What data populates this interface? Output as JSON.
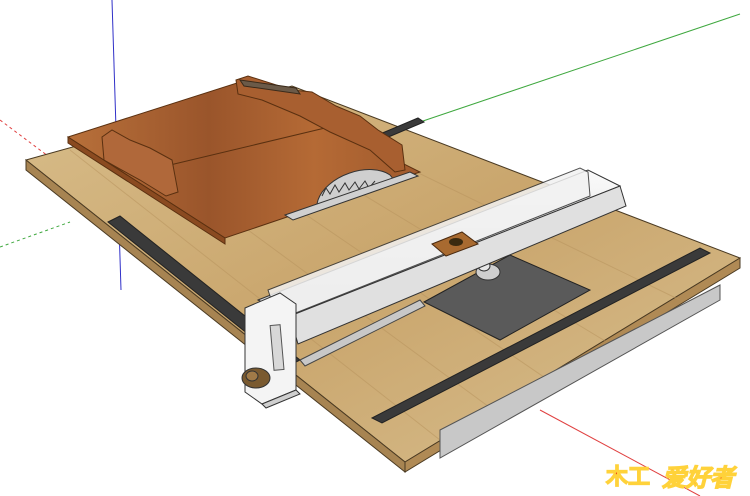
{
  "viewport": {
    "background": "#ffffff"
  },
  "axes": {
    "red": "#e04040",
    "green": "#3fa83f",
    "blue": "#3030c8"
  },
  "model": {
    "table_top_color": "#d2b27a",
    "edge_color": "#a78452",
    "sled_color": "#a85f30",
    "fence_color": "#eeeeee",
    "insert_plate_color": "#5a5a5a",
    "track_color": "#3a3a3a"
  },
  "watermark": {
    "text": "爱好者",
    "glyph": "木工",
    "text_color": "#e8290f",
    "outline_color": "#ffd23a"
  }
}
